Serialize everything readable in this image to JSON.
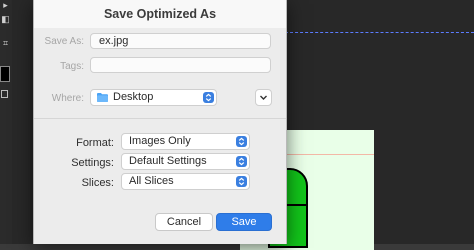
{
  "dialog": {
    "title": "Save Optimized As",
    "save_as_label": "Save As:",
    "save_as_value": "ex.jpg",
    "tags_label": "Tags:",
    "tags_value": "",
    "where_label": "Where:",
    "where_value": "Desktop",
    "format_label": "Format:",
    "format_value": "Images Only",
    "settings_label": "Settings:",
    "settings_value": "Default Settings",
    "slices_label": "Slices:",
    "slices_value": "All Slices",
    "cancel_label": "Cancel",
    "save_label": "Save"
  },
  "colors": {
    "accent": "#2f7de9",
    "shape_fill": "#12c51a",
    "document_bg": "#e9ffe8"
  },
  "icons": [
    "folder-icon",
    "popup-stepper-icon",
    "chevron-down-icon"
  ]
}
